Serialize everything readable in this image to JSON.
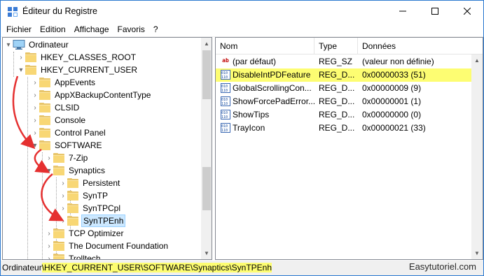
{
  "window": {
    "title": "Éditeur du Registre",
    "controls": [
      "minimize",
      "maximize",
      "close"
    ]
  },
  "menu": {
    "items": [
      "Fichier",
      "Edition",
      "Affichage",
      "Favoris",
      "?"
    ]
  },
  "tree": {
    "root": "Ordinateur",
    "items": [
      {
        "label": "HKEY_CLASSES_ROOT",
        "level": 1,
        "expanded": false
      },
      {
        "label": "HKEY_CURRENT_USER",
        "level": 1,
        "expanded": true
      },
      {
        "label": "AppEvents",
        "level": 2,
        "expanded": false
      },
      {
        "label": "AppXBackupContentType",
        "level": 2,
        "expanded": false
      },
      {
        "label": "CLSID",
        "level": 2,
        "expanded": false
      },
      {
        "label": "Console",
        "level": 2,
        "expanded": false
      },
      {
        "label": "Control Panel",
        "level": 2,
        "expanded": false
      },
      {
        "label": "SOFTWARE",
        "level": 2,
        "expanded": true
      },
      {
        "label": "7-Zip",
        "level": 3,
        "expanded": false
      },
      {
        "label": "Synaptics",
        "level": 3,
        "expanded": true
      },
      {
        "label": "Persistent",
        "level": 4,
        "expanded": false
      },
      {
        "label": "SynTP",
        "level": 4,
        "expanded": false
      },
      {
        "label": "SynTPCpl",
        "level": 4,
        "expanded": false
      },
      {
        "label": "SynTPEnh",
        "level": 4,
        "expanded": false,
        "selected": true
      },
      {
        "label": "TCP Optimizer",
        "level": 3,
        "expanded": false
      },
      {
        "label": "The Document Foundation",
        "level": 3,
        "expanded": false
      },
      {
        "label": "Trolltech",
        "level": 3,
        "expanded": false
      }
    ]
  },
  "list": {
    "columns": [
      "Nom",
      "Type",
      "Données"
    ],
    "rows": [
      {
        "icon": "string-value-icon",
        "name": "(par défaut)",
        "type": "REG_SZ",
        "data": "(valeur non définie)",
        "highlighted": false
      },
      {
        "icon": "binary-value-icon",
        "name": "DisableIntPDFeature",
        "type": "REG_D...",
        "data": "0x00000033 (51)",
        "highlighted": true
      },
      {
        "icon": "binary-value-icon",
        "name": "GlobalScrollingCon...",
        "type": "REG_D...",
        "data": "0x00000009 (9)",
        "highlighted": false
      },
      {
        "icon": "binary-value-icon",
        "name": "ShowForcePadError...",
        "type": "REG_D...",
        "data": "0x00000001 (1)",
        "highlighted": false
      },
      {
        "icon": "binary-value-icon",
        "name": "ShowTips",
        "type": "REG_D...",
        "data": "0x00000000 (0)",
        "highlighted": false
      },
      {
        "icon": "binary-value-icon",
        "name": "TrayIcon",
        "type": "REG_D...",
        "data": "0x00000021 (33)",
        "highlighted": false
      }
    ]
  },
  "status": {
    "prefix": "Ordinateur",
    "path": "\\HKEY_CURRENT_USER\\SOFTWARE\\Synaptics\\SynTPEnh",
    "watermark": "Easytutoriel.com"
  },
  "colors": {
    "highlight": "#fdfd72",
    "selection": "#cce8ff",
    "annotation": "#e53030",
    "folder": "#f8d775"
  }
}
